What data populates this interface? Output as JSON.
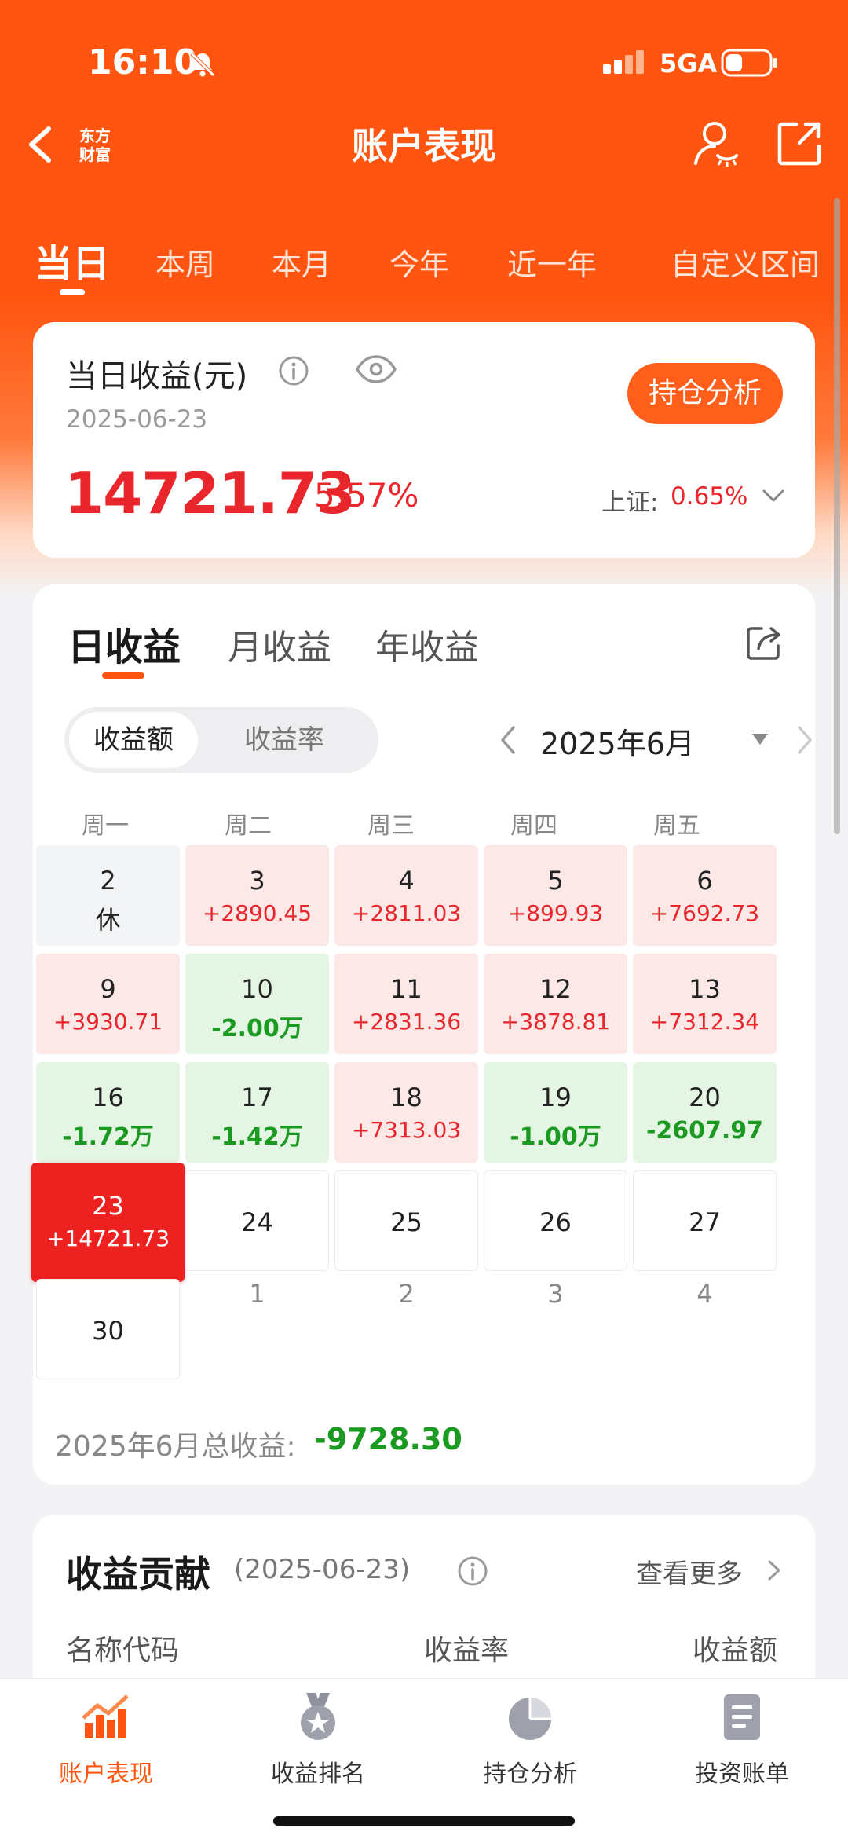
{
  "status_bar": {
    "time": "16:10",
    "network": "5GA"
  },
  "nav": {
    "logo_line1": "东方",
    "logo_line2": "财富",
    "title": "账户表现"
  },
  "period_tabs": [
    "当日",
    "本周",
    "本月",
    "今年",
    "近一年",
    "自定义区间"
  ],
  "summary": {
    "title": "当日收益(元)",
    "date": "2025-06-23",
    "amount": "14721.73",
    "rate": "5.57%",
    "holding_button": "持仓分析",
    "index_label": "上证:",
    "index_value": "0.65%"
  },
  "calendar_tabs": [
    "日收益",
    "月收益",
    "年收益"
  ],
  "toggle": {
    "on": "收益额",
    "off": "收益率"
  },
  "month_label": "2025年6月",
  "weekdays": [
    "周一",
    "周二",
    "周三",
    "周四",
    "周五"
  ],
  "calendar": {
    "rows": [
      [
        {
          "day": "2",
          "value": "休",
          "state": "rest"
        },
        {
          "day": "3",
          "value": "+2890.45",
          "state": "up"
        },
        {
          "day": "4",
          "value": "+2811.03",
          "state": "up"
        },
        {
          "day": "5",
          "value": "+899.93",
          "state": "up"
        },
        {
          "day": "6",
          "value": "+7692.73",
          "state": "up"
        }
      ],
      [
        {
          "day": "9",
          "value": "+3930.71",
          "state": "up"
        },
        {
          "day": "10",
          "value": "-2.00万",
          "state": "down"
        },
        {
          "day": "11",
          "value": "+2831.36",
          "state": "up"
        },
        {
          "day": "12",
          "value": "+3878.81",
          "state": "up"
        },
        {
          "day": "13",
          "value": "+7312.34",
          "state": "up"
        }
      ],
      [
        {
          "day": "16",
          "value": "-1.72万",
          "state": "down"
        },
        {
          "day": "17",
          "value": "-1.42万",
          "state": "down"
        },
        {
          "day": "18",
          "value": "+7313.03",
          "state": "up"
        },
        {
          "day": "19",
          "value": "-1.00万",
          "state": "down"
        },
        {
          "day": "20",
          "value": "-2607.97",
          "state": "down"
        }
      ],
      [
        {
          "day": "23",
          "value": "+14721.73",
          "state": "today"
        },
        {
          "day": "24",
          "value": "",
          "state": "empty"
        },
        {
          "day": "25",
          "value": "",
          "state": "empty"
        },
        {
          "day": "26",
          "value": "",
          "state": "empty"
        },
        {
          "day": "27",
          "value": "",
          "state": "empty"
        }
      ],
      [
        {
          "day": "30",
          "value": "",
          "state": "empty"
        },
        {
          "day": "1",
          "value": "",
          "state": "other"
        },
        {
          "day": "2",
          "value": "",
          "state": "other"
        },
        {
          "day": "3",
          "value": "",
          "state": "other"
        },
        {
          "day": "4",
          "value": "",
          "state": "other"
        }
      ]
    ]
  },
  "month_total": {
    "label": "2025年6月总收益:",
    "value": "-9728.30"
  },
  "contribution": {
    "title": "收益贡献",
    "date": "(2025-06-23)",
    "more": "查看更多",
    "columns": [
      "名称代码",
      "收益率",
      "收益额"
    ]
  },
  "tab_bar": [
    {
      "label": "账户表现",
      "icon": "trend-chart-icon",
      "active": true
    },
    {
      "label": "收益排名",
      "icon": "medal-icon",
      "active": false
    },
    {
      "label": "持仓分析",
      "icon": "pie-chart-icon",
      "active": false
    },
    {
      "label": "投资账单",
      "icon": "document-icon",
      "active": false
    }
  ],
  "colors": {
    "brand": "#ff5510",
    "gain": "#e8262c",
    "loss": "#1a9a20",
    "today": "#ee2121"
  }
}
